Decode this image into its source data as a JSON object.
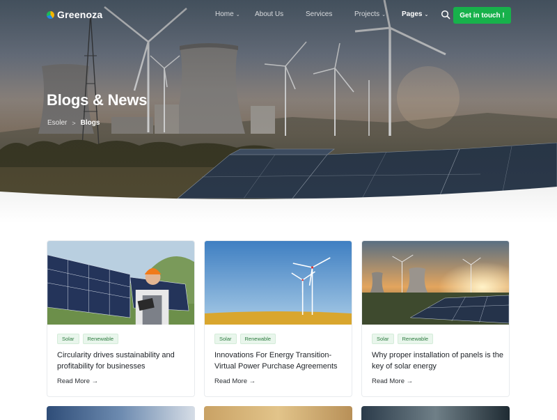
{
  "nav": {
    "brand": "Greenoza",
    "items": [
      {
        "label": "Home",
        "has_dropdown": true
      },
      {
        "label": "About Us",
        "has_dropdown": false
      },
      {
        "label": "Services",
        "has_dropdown": false
      },
      {
        "label": "Projects",
        "has_dropdown": true
      },
      {
        "label": "Pages",
        "has_dropdown": true,
        "active": true
      }
    ],
    "search_icon": "search-icon",
    "cta_label": "Get in touch !"
  },
  "hero": {
    "title": "Blogs & News",
    "breadcrumb": {
      "home": "Esoler",
      "separator": ">",
      "current": "Blogs"
    }
  },
  "posts": [
    {
      "tags": [
        "Solar",
        "Renewable"
      ],
      "title": "Circularity drives sustainability and profitability for businesses",
      "read_more": "Read More →"
    },
    {
      "tags": [
        "Solar",
        "Renewable"
      ],
      "title": "Innovations For Energy Transition- Virtual Power Purchase Agreements",
      "read_more": "Read More →"
    },
    {
      "tags": [
        "Solar",
        "Renewable"
      ],
      "title": "Why proper installation of panels is the key of solar energy",
      "read_more": "Read More →"
    }
  ],
  "colors": {
    "accent": "#17b14b",
    "tag_bg": "#e9f6ec",
    "tag_text": "#2c7a3e"
  }
}
